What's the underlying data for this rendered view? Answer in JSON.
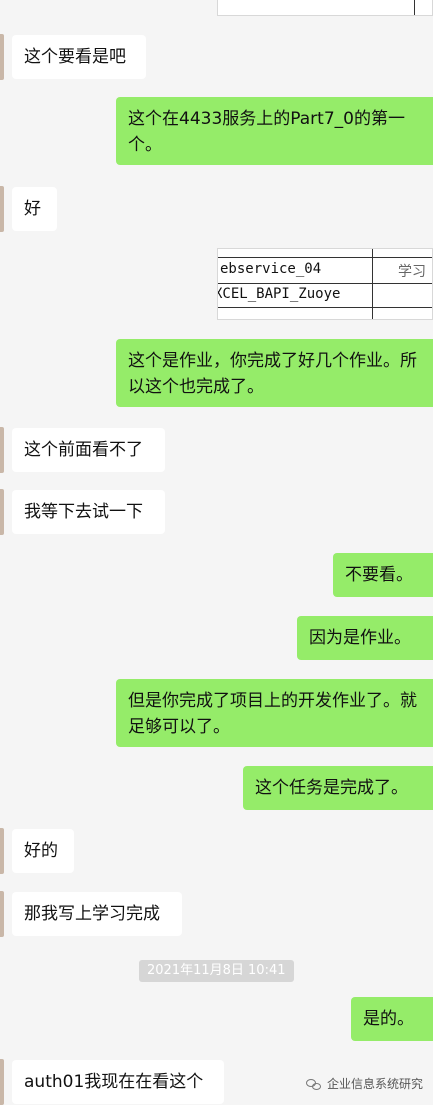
{
  "messages": [
    {
      "side": "in",
      "text": "这个要看是吧"
    },
    {
      "side": "out",
      "text": "这个在4433服务上的Part7_0的第一个。"
    },
    {
      "side": "in",
      "text": "好"
    },
    {
      "side": "out",
      "text": "这个是作业，你完成了好几个作业。所以这个也完成了。"
    },
    {
      "side": "in",
      "text": "这个前面看不了"
    },
    {
      "side": "in",
      "text": "我等下去试一下"
    },
    {
      "side": "out",
      "text": "不要看。"
    },
    {
      "side": "out",
      "text": "因为是作业。"
    },
    {
      "side": "out",
      "text": "但是你完成了项目上的开发作业了。就足够可以了。"
    },
    {
      "side": "out",
      "text": "这个任务是完成了。"
    },
    {
      "side": "in",
      "text": "好的"
    },
    {
      "side": "in",
      "text": "那我写上学习完成"
    },
    {
      "side": "out",
      "text": "是的。"
    },
    {
      "side": "in",
      "text": "auth01我现在在看这个"
    }
  ],
  "shared_image": {
    "row1_col1": "ebservice_04",
    "row1_col2": "学习",
    "row2_col1": "XCEL_BAPI_Zuoye"
  },
  "timestamp": "2021年11月8日 10:41",
  "watermark": "企业信息系统研究",
  "colors": {
    "outgoing_bubble": "#95ec69",
    "incoming_bubble": "#ffffff",
    "background": "#f5f5f5"
  }
}
